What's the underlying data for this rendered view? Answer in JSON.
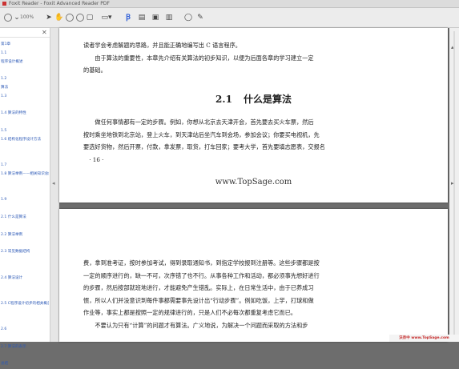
{
  "window": {
    "title": "Foxit Reader - Foxit Advanced Reader PDF"
  },
  "toolbar": {
    "zoom": "100%"
  },
  "sidebar": {
    "items": [
      "第1章",
      "1.1",
      "程序设计概述",
      "",
      "1.2",
      "算法",
      "1.3",
      "",
      "1.4 算法的特性",
      "",
      "1.5",
      "1.6 结构化程序设计方法",
      "",
      "",
      "1.7",
      "1.8 算法举例——相关知识总结",
      "",
      "",
      "1.9",
      "",
      "2.1 什么是算法",
      "",
      "2.2 算法举例",
      "",
      "2.3 常见数据结构",
      "",
      "",
      "2.4 算法设计",
      "",
      "",
      "2.5 C程序设计初步的相关概念",
      "",
      "",
      "2.6",
      "",
      "2.7 算法的表示",
      "",
      "总结"
    ]
  },
  "pages": {
    "p1": {
      "intro_lines": [
        "读者学会考虑解题的思路，并且能正确地编写出 C 语言程序。",
        "由于算法的重要性，本章先介绍有关算法的初步知识，以便为后面各章的学习建立一定",
        "的基础。"
      ],
      "heading_num": "2.1",
      "heading_text": "什么是算法",
      "body_lines": [
        "做任何事情都有一定的步骤。例如，你想从北京去天津开会，首先要去买火车票，然后",
        "按时乘坐地铁到北京站，登上火车，到天津站后坐汽车到会场，参加会议；你要买电视机，先",
        "要选好货物，然后开票，付款，拿发票，取货，打车回家；要考大学，首先要填志愿表，交报名",
        "· 16 ·"
      ],
      "watermark": "www.TopSage.com"
    },
    "p2": {
      "body_lines": [
        "费，拿到准考证，按时参加考试，得到录取通知书，到指定学校报到注册等。这些步骤都是按",
        "一定的顺序进行的，缺一不可，次序错了也不行。从事各种工作和活动，都必须事先想好进行",
        "的步骤，然后按部就班地进行，才能避免产生错乱。实际上，在日常生活中，由于已养成习",
        "惯，所以人们并没意识到每件事都需要事先设计出“行动步骤”。例如吃饭，上学，打球和做",
        "作业等，事实上都是按照一定的规律进行的，只是人们不必每次都重复考虑它而已。",
        "不要认为只有“计算”的问题才有算法。广义地说，为解决一个问题而采取的方法和步"
      ]
    }
  },
  "footer": {
    "badge": "沃奈中 www.TopSage.com"
  }
}
